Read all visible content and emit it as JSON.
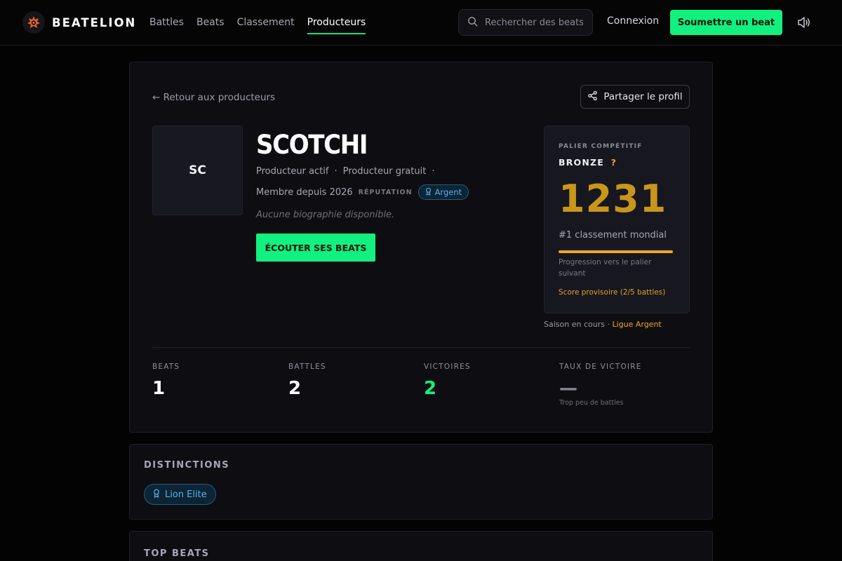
{
  "nav": {
    "brand": "BEATELION",
    "links": [
      {
        "label": "Battles",
        "active": false
      },
      {
        "label": "Beats",
        "active": false
      },
      {
        "label": "Classement",
        "active": false
      },
      {
        "label": "Producteurs",
        "active": true
      }
    ],
    "search_placeholder": "Rechercher des beats",
    "login": "Connexion",
    "submit": "Soumettre un beat",
    "accent_color": "#12f07f"
  },
  "profile": {
    "back": "← Retour aux producteurs",
    "share": "Partager le profil",
    "initials": "SC",
    "name": "SCOTCHI",
    "status": "Producteur actif",
    "sep1": "·",
    "plan": "Producteur gratuit",
    "sep2": "·",
    "member_since": "Membre depuis 2026",
    "reputation_label": "RÉPUTATION",
    "reputation_badge": "Argent",
    "bio": "Aucune biographie disponible.",
    "listen": "ÉCOUTER SES BEATS"
  },
  "tier": {
    "label": "PALIER COMPÉTITIF",
    "name": "BRONZE",
    "help": "?",
    "score": "1231",
    "rank": "#1 classement mondial",
    "progress_fraction": 1.0,
    "progress_label": "Progression vers le palier suivant",
    "provisional": "Score provisoire (2/5 battles)",
    "season_prefix": "Saison en cours · ",
    "season_league": "Ligue Argent",
    "score_color": "#c8961a"
  },
  "stats": [
    {
      "label": "BEATS",
      "value": "1"
    },
    {
      "label": "BATTLES",
      "value": "2"
    },
    {
      "label": "VICTOIRES",
      "value": "2"
    },
    {
      "label": "TAUX DE VICTOIRE",
      "value": "—",
      "sub": "Trop peu de battles"
    }
  ],
  "distinctions": {
    "title": "DISTINCTIONS",
    "badges": [
      "Lion Elite"
    ]
  },
  "top_beats": {
    "title": "TOP BEATS"
  }
}
